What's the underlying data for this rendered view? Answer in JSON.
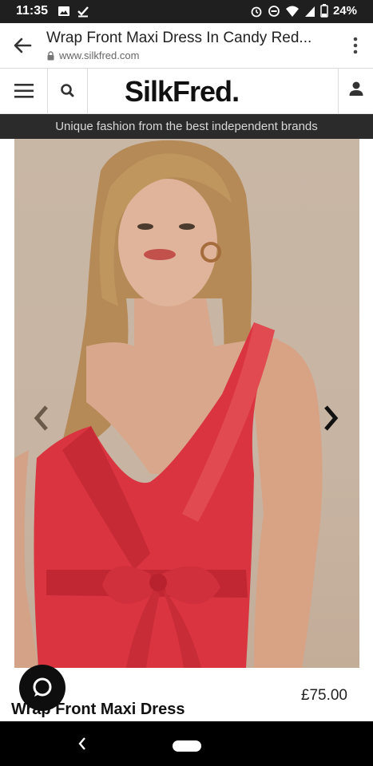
{
  "status_bar": {
    "time": "11:35",
    "battery": "24%"
  },
  "browser": {
    "page_title": "Wrap Front Maxi Dress In Candy Red...",
    "url": "www.silkfred.com"
  },
  "site": {
    "logo": "SilkFred",
    "logo_dot": ".",
    "tagline": "Unique fashion from the best independent brands"
  },
  "product": {
    "name": "Wrap Front Maxi Dress",
    "price": "£75.00"
  },
  "colors": {
    "dress": "#d9343f",
    "dark_band": "#2b2b2b"
  }
}
